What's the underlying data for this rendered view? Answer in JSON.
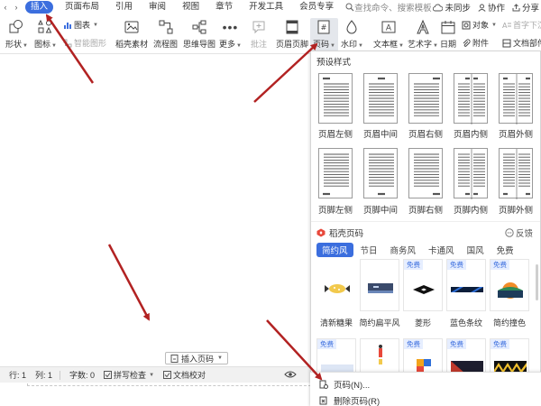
{
  "menubar": {
    "tabs": [
      "插入",
      "页面布局",
      "引用",
      "审阅",
      "视图",
      "章节",
      "开发工具",
      "会员专享"
    ],
    "active_tab": "插入",
    "search_text": "查找命令、搜索模板",
    "right": {
      "sync": "未同步",
      "collab": "协作",
      "share": "分享"
    }
  },
  "ribbon": {
    "shape": "形状",
    "icon": "图标",
    "chart": "图表",
    "smart_shape": "智能图形",
    "shell_material": "稻壳素材",
    "flowchart": "流程图",
    "mindmap": "思维导图",
    "more": "更多",
    "comment": "批注",
    "header_footer": "页眉页脚",
    "page_number": "页码",
    "watermark": "水印",
    "textbox": "文本框",
    "wordart": "艺术字",
    "date": "日期",
    "object": "对象",
    "attachment": "附件",
    "dropcap": "首字下沉",
    "doc_parts": "文档部件"
  },
  "doc": {
    "insert_page_number_btn": "插入页码"
  },
  "statusbar": {
    "row": "行: 1",
    "col": "列: 1",
    "wordcount": "字数: 0",
    "spellcheck": "拼写检查",
    "proofread": "文档校对"
  },
  "panel": {
    "preset_title": "预设样式",
    "header_styles": [
      "页眉左侧",
      "页眉中间",
      "页眉右侧",
      "页眉内侧",
      "页眉外侧"
    ],
    "footer_styles": [
      "页脚左侧",
      "页脚中间",
      "页脚右侧",
      "页脚内侧",
      "页脚外侧"
    ],
    "shell_title": "稻壳页码",
    "feedback": "反馈",
    "categories": [
      "简约风",
      "节日",
      "商务风",
      "卡通风",
      "国风",
      "免费"
    ],
    "active_category": "简约风",
    "free_badge": "免费",
    "thumbs": [
      "清新糖果",
      "简约扁平风",
      "菱形",
      "蓝色条纹",
      "简约撞色"
    ]
  },
  "popup": {
    "page_number_item": "页码(N)...",
    "delete_page_number_item": "删除页码(R)"
  },
  "colors": {
    "accent": "#3b6ede",
    "arrow": "#b22222"
  }
}
